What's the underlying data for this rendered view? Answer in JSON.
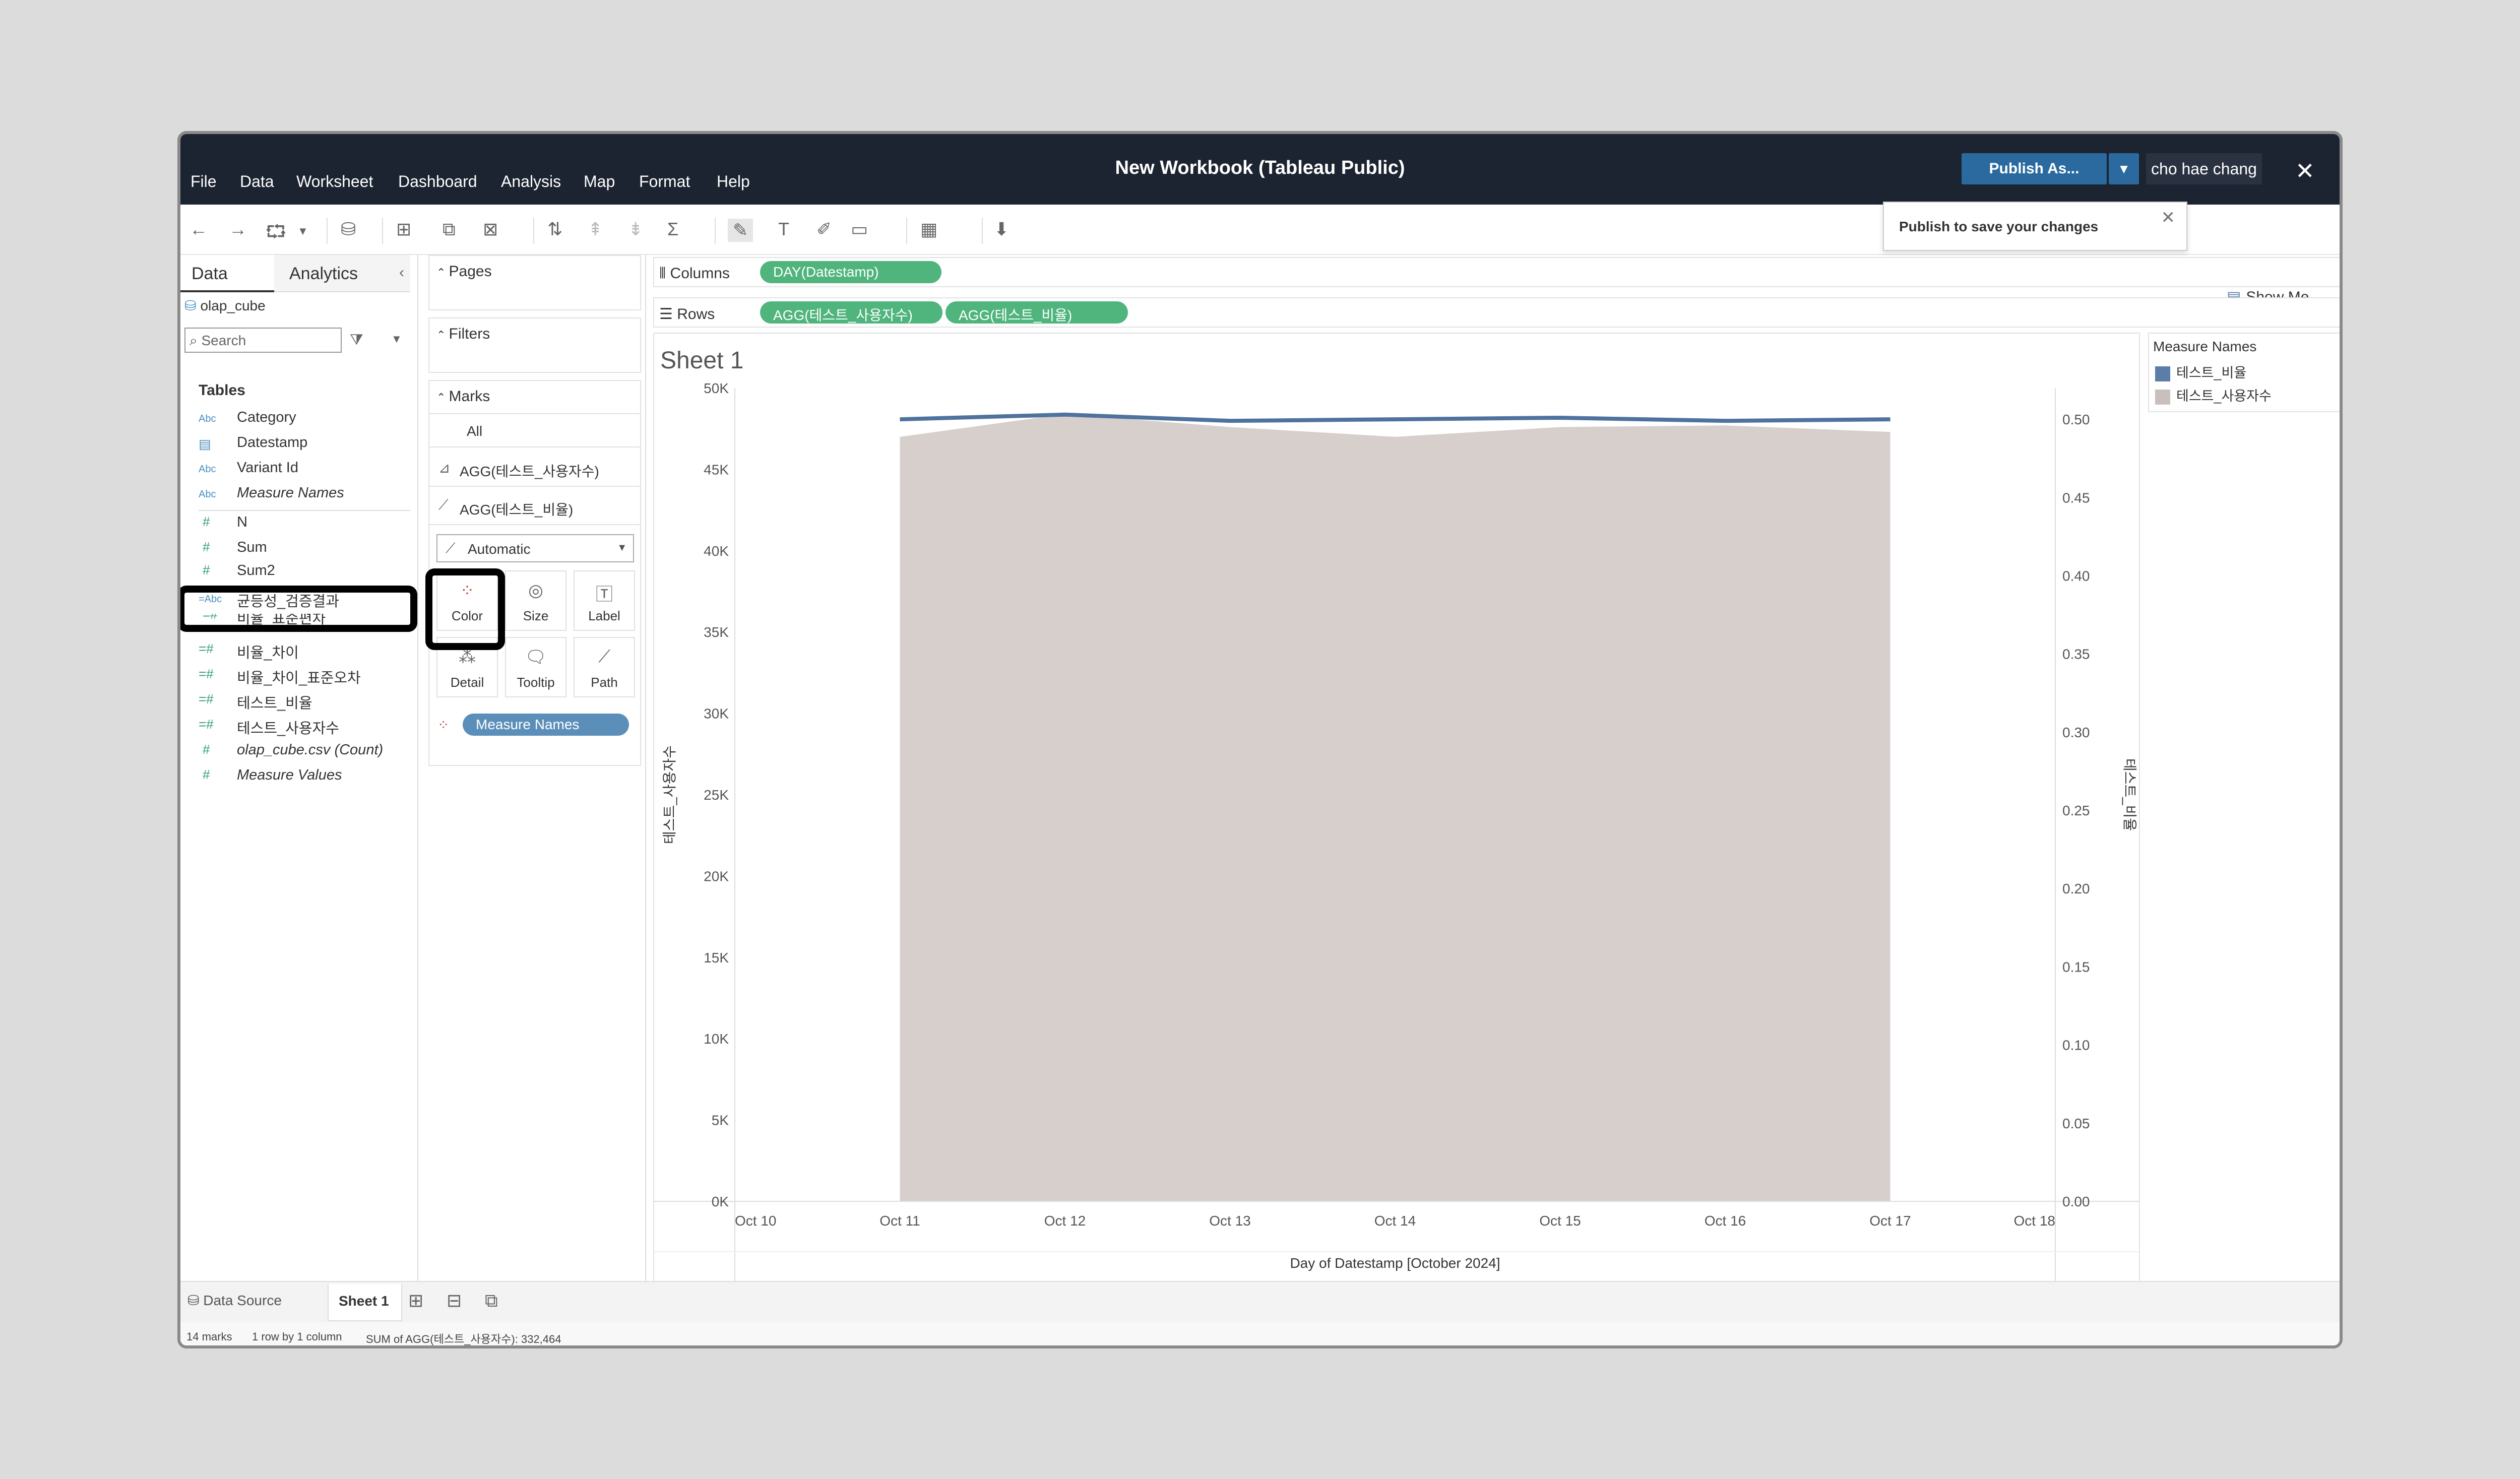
{
  "window": {
    "title": "New Workbook (Tableau Public)"
  },
  "menu": [
    "File",
    "Data",
    "Worksheet",
    "Dashboard",
    "Analysis",
    "Map",
    "Format",
    "Help"
  ],
  "header": {
    "publish_label": "Publish As...",
    "user_name": "cho hae chang",
    "publish_tip": "Publish to save your changes",
    "show_me": "Show Me"
  },
  "left_pane": {
    "tabs": [
      "Data",
      "Analytics"
    ],
    "datasource": "olap_cube",
    "search_placeholder": "Search",
    "tables_heading": "Tables",
    "fields": [
      {
        "name": "Category",
        "kind": "Abc"
      },
      {
        "name": "Datestamp",
        "kind": "date"
      },
      {
        "name": "Variant Id",
        "kind": "Abc"
      },
      {
        "name": "Measure Names",
        "kind": "Abc"
      },
      {
        "name": "N",
        "kind": "#"
      },
      {
        "name": "Sum",
        "kind": "#"
      },
      {
        "name": "Sum2",
        "kind": "#"
      },
      {
        "name": "균등성_검증결과",
        "kind": "=Abc"
      },
      {
        "name": "비율_표준편차",
        "kind": "=#"
      },
      {
        "name": "비율_차이",
        "kind": "=#"
      },
      {
        "name": "비율_차이_표준오차",
        "kind": "=#"
      },
      {
        "name": "테스트_비율",
        "kind": "=#"
      },
      {
        "name": "테스트_사용자수",
        "kind": "=#"
      },
      {
        "name": "olap_cube.csv (Count)",
        "kind": "#"
      },
      {
        "name": "Measure Values",
        "kind": "#"
      }
    ]
  },
  "cards": {
    "pages": "Pages",
    "filters": "Filters",
    "marks": "Marks",
    "marks_all": "All",
    "marks_1": "AGG(테스트_사용자수)",
    "marks_2": "AGG(테스트_비율)",
    "mark_type": "Automatic",
    "buttons": [
      "Color",
      "Size",
      "Label",
      "Detail",
      "Tooltip",
      "Path"
    ],
    "color_pill": "Measure Names"
  },
  "shelves": {
    "columns_label": "Columns",
    "rows_label": "Rows",
    "columns_pill": "DAY(Datestamp)",
    "rows_pills": [
      "AGG(테스트_사용자수)",
      "AGG(테스트_비율)"
    ]
  },
  "sheet": {
    "title": "Sheet 1"
  },
  "legend": {
    "title": "Measure Names",
    "items": [
      {
        "label": "테스트_비율",
        "color": "#5b7ea9"
      },
      {
        "label": "테스트_사용자수",
        "color": "#c9bfbc"
      }
    ]
  },
  "chart_data": {
    "type": "area",
    "x": [
      "Oct 11",
      "Oct 12",
      "Oct 13",
      "Oct 14",
      "Oct 15",
      "Oct 16",
      "Oct 17"
    ],
    "x_ticks": [
      "Oct 10",
      "Oct 11",
      "Oct 12",
      "Oct 13",
      "Oct 14",
      "Oct 15",
      "Oct 16",
      "Oct 17",
      "Oct 18"
    ],
    "xlabel": "Day of Datestamp [October 2024]",
    "ylabel": "테스트_사용자수",
    "y2label": "테스트_비율",
    "ylim": [
      0,
      50000
    ],
    "y2lim": [
      0,
      0.52
    ],
    "y_ticks": [
      "0K",
      "5K",
      "10K",
      "15K",
      "20K",
      "25K",
      "30K",
      "35K",
      "40K",
      "45K",
      "50K"
    ],
    "y2_ticks": [
      "0.00",
      "0.05",
      "0.10",
      "0.15",
      "0.20",
      "0.25",
      "0.30",
      "0.35",
      "0.40",
      "0.45",
      "0.50"
    ],
    "series": [
      {
        "name": "테스트_사용자수",
        "axis": "left",
        "mark": "area",
        "color": "#d7cfcc",
        "values": [
          47000,
          48400,
          47600,
          47000,
          47600,
          47700,
          47300
        ]
      },
      {
        "name": "테스트_비율",
        "axis": "right",
        "mark": "line",
        "color": "#4f729f",
        "values": [
          0.5,
          0.503,
          0.499,
          0.5,
          0.501,
          0.499,
          0.5
        ]
      }
    ]
  },
  "bottom": {
    "datasource_tab": "Data Source",
    "sheet_tab": "Sheet 1"
  },
  "status": {
    "marks": "14 marks",
    "dims": "1 row by 1 column",
    "sum": "SUM of AGG(테스트_사용자수): 332,464"
  }
}
